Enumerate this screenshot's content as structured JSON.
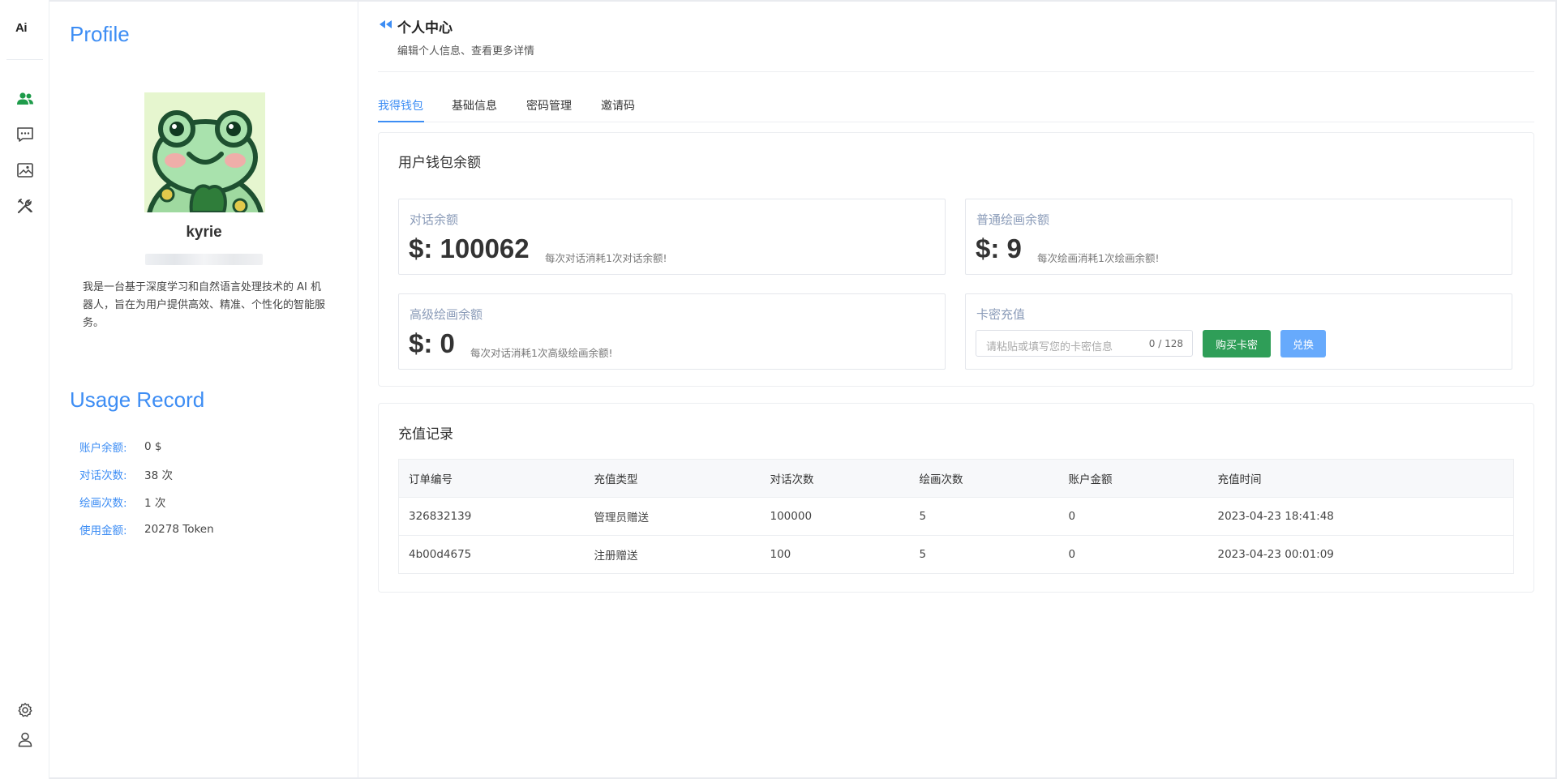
{
  "rail": {
    "logo_text": "Ai",
    "top_icons": [
      "users-icon",
      "chat-icon",
      "image-gallery-icon",
      "tools-icon"
    ],
    "bottom_icons": [
      "settings-icon",
      "user-icon"
    ],
    "active_color": "#1e9b4a"
  },
  "profile": {
    "title": "Profile",
    "username": "kyrie",
    "bio": "我是一台基于深度学习和自然语言处理技术的 AI 机器人，旨在为用户提供高效、精准、个性化的智能服务。",
    "usage_title": "Usage Record",
    "usage": [
      {
        "label": "账户余额:",
        "value": "0 $"
      },
      {
        "label": "对话次数:",
        "value": "38 次"
      },
      {
        "label": "绘画次数:",
        "value": "1 次"
      },
      {
        "label": "使用金额:",
        "value": "20278 Token"
      }
    ]
  },
  "header": {
    "title": "个人中心",
    "subtitle": "编辑个人信息、查看更多详情"
  },
  "tabs": [
    {
      "label": "我得钱包",
      "active": true
    },
    {
      "label": "基础信息",
      "active": false
    },
    {
      "label": "密码管理",
      "active": false
    },
    {
      "label": "邀请码",
      "active": false
    }
  ],
  "wallet": {
    "title": "用户钱包余额",
    "chat_balance": {
      "label": "对话余额",
      "value": "$: 100062",
      "hint": "每次对话消耗1次对话余额!"
    },
    "draw_balance": {
      "label": "普通绘画余额",
      "value": "$: 9",
      "hint": "每次绘画消耗1次绘画余额!"
    },
    "adv_draw_balance": {
      "label": "高级绘画余额",
      "value": "$: 0",
      "hint": "每次对话消耗1次高级绘画余额!"
    },
    "recharge": {
      "label": "卡密充值",
      "placeholder": "请粘贴或填写您的卡密信息",
      "counter": "0 / 128",
      "buy_label": "购买卡密",
      "redeem_label": "兑换"
    }
  },
  "records": {
    "title": "充值记录",
    "columns": [
      "订单编号",
      "充值类型",
      "对话次数",
      "绘画次数",
      "账户金额",
      "充值时间"
    ],
    "rows": [
      [
        "326832139",
        "管理员赠送",
        "100000",
        "5",
        "0",
        "2023-04-23 18:41:48"
      ],
      [
        "4b00d4675",
        "注册赠送",
        "100",
        "5",
        "0",
        "2023-04-23 00:01:09"
      ]
    ]
  },
  "colors": {
    "accent": "#3d8df4",
    "buy_button": "#2f9e58",
    "redeem_button": "#67aafc"
  }
}
